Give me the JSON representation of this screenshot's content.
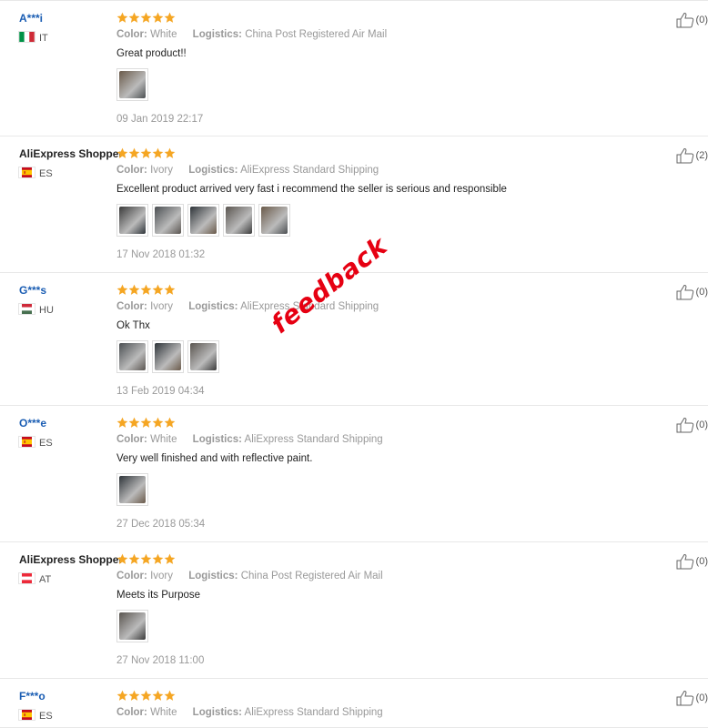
{
  "colors": {
    "star": "#f5a623",
    "masked_name": "#1a5db3",
    "watermark": "#e60012"
  },
  "watermark": "feedback",
  "reviews": [
    {
      "name": "A***i",
      "masked": true,
      "country": "IT",
      "flag": "italy",
      "color_label": "Color:",
      "color": "White",
      "logistics_label": "Logistics:",
      "logistics": "China Post Registered Air Mail",
      "text": "Great product!!",
      "photos": 1,
      "date": "09 Jan 2019 22:17",
      "helpful": "(0)",
      "stars": 5
    },
    {
      "name": "AliExpress Shopper",
      "masked": false,
      "country": "ES",
      "flag": "spain",
      "color_label": "Color:",
      "color": "Ivory",
      "logistics_label": "Logistics:",
      "logistics": "AliExpress Standard Shipping",
      "text": "Excellent product arrived very fast i recommend the seller is serious and responsible",
      "photos": 5,
      "date": "17 Nov 2018 01:32",
      "helpful": "(2)",
      "stars": 5
    },
    {
      "name": "G***s",
      "masked": true,
      "country": "HU",
      "flag": "hungary",
      "color_label": "Color:",
      "color": "Ivory",
      "logistics_label": "Logistics:",
      "logistics": "AliExpress Standard Shipping",
      "text": "Ok Thx",
      "photos": 3,
      "date": "13 Feb 2019 04:34",
      "helpful": "(0)",
      "stars": 5
    },
    {
      "name": "O***e",
      "masked": true,
      "country": "ES",
      "flag": "spain",
      "color_label": "Color:",
      "color": "White",
      "logistics_label": "Logistics:",
      "logistics": "AliExpress Standard Shipping",
      "text": "Very well finished and with reflective paint.",
      "photos": 1,
      "date": "27 Dec 2018 05:34",
      "helpful": "(0)",
      "stars": 5
    },
    {
      "name": "AliExpress Shopper",
      "masked": false,
      "country": "AT",
      "flag": "austria",
      "color_label": "Color:",
      "color": "Ivory",
      "logistics_label": "Logistics:",
      "logistics": "China Post Registered Air Mail",
      "text": "Meets its Purpose",
      "photos": 1,
      "date": "27 Nov 2018 11:00",
      "helpful": "(0)",
      "stars": 5
    },
    {
      "name": "F***o",
      "masked": true,
      "country": "ES",
      "flag": "spain",
      "color_label": "Color:",
      "color": "White",
      "logistics_label": "Logistics:",
      "logistics": "AliExpress Standard Shipping",
      "text": "",
      "photos": 0,
      "date": "",
      "helpful": "(0)",
      "stars": 5
    }
  ]
}
